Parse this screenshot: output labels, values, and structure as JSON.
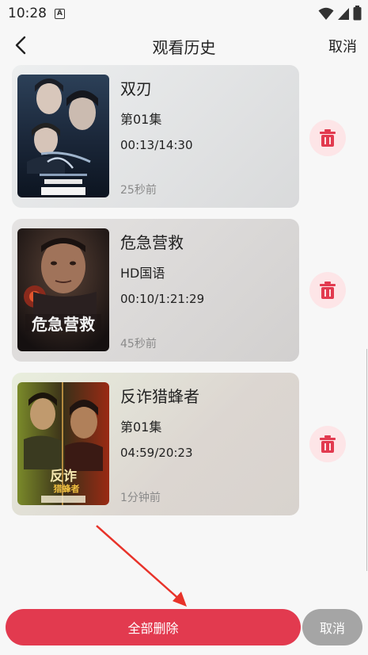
{
  "status_bar": {
    "time": "10:28",
    "notification_letter": "A"
  },
  "nav": {
    "title": "观看历史",
    "cancel": "取消"
  },
  "items": [
    {
      "title": "双刃",
      "episode": "第01集",
      "progress": "00:13/14:30",
      "time_ago": "25秒前"
    },
    {
      "title": "危急营救",
      "episode": "HD国语",
      "progress": "00:10/1:21:29",
      "time_ago": "45秒前"
    },
    {
      "title": "反诈猎蜂者",
      "episode": "第01集",
      "progress": "04:59/20:23",
      "time_ago": "1分钟前"
    }
  ],
  "bottom": {
    "delete_all": "全部删除",
    "cancel": "取消"
  },
  "colors": {
    "accent": "#e23a4f",
    "delete_icon": "#e23a4f",
    "cancel_gray": "#a5a5a5"
  }
}
